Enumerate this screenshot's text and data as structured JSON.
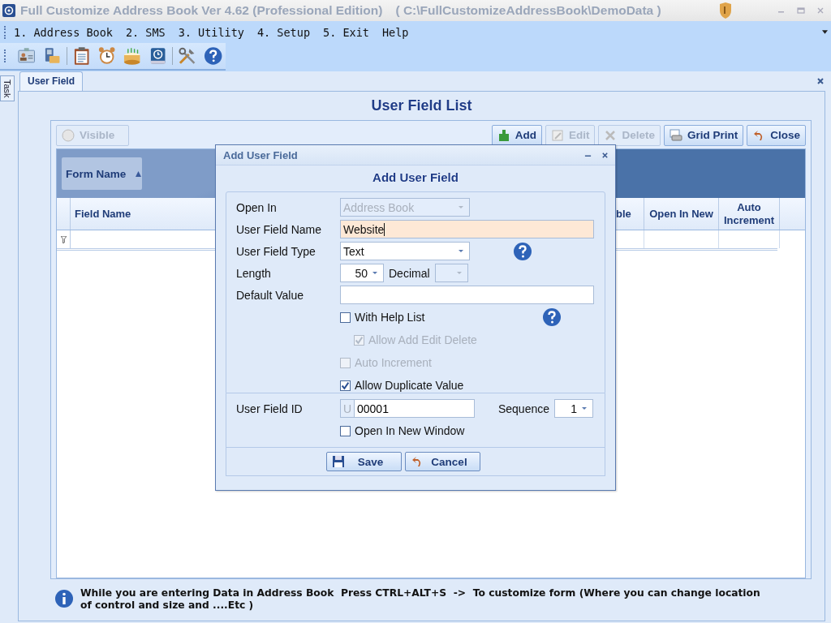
{
  "window": {
    "title": "Full Customize Address Book Ver 4.62 (Professional Edition)",
    "path": "( C:\\FullCustomizeAddressBook\\DemoData )"
  },
  "menu": [
    {
      "label": "1. Address Book"
    },
    {
      "label": "2. SMS"
    },
    {
      "label": "3. Utility"
    },
    {
      "label": "4. Setup"
    },
    {
      "label": "5. Exit"
    },
    {
      "label": "Help"
    }
  ],
  "side_tab": "Task",
  "tabs": [
    {
      "label": "User Field",
      "selected": true
    }
  ],
  "heading": "User Field List",
  "toolbar_buttons": [
    {
      "label": "Visible",
      "kind": "radio",
      "disabled": true
    },
    {
      "label": "Add",
      "kind": "add",
      "disabled": false
    },
    {
      "label": "Edit",
      "kind": "edit",
      "disabled": true
    },
    {
      "label": "Delete",
      "kind": "delete",
      "disabled": true
    },
    {
      "label": "Grid Print",
      "kind": "print",
      "disabled": false
    },
    {
      "label": "Close",
      "kind": "close",
      "disabled": false
    }
  ],
  "group_panel": {
    "label": "Form Name"
  },
  "grid": {
    "columns": [
      "Field Name",
      "ble",
      "Open In New",
      "Auto Increment"
    ]
  },
  "dialog": {
    "title": "Add User Field",
    "heading": "Add User Field",
    "open_in": {
      "label": "Open In",
      "value": "Address Book",
      "disabled": true
    },
    "name": {
      "label": "User Field Name",
      "value": "Website"
    },
    "type": {
      "label": "User Field Type",
      "value": "Text"
    },
    "length": {
      "label": "Length",
      "value": "50",
      "decimal_label": "Decimal"
    },
    "default": {
      "label": "Default Value"
    },
    "options": [
      {
        "label": "With Help List",
        "checked": false,
        "disabled": false,
        "children": [
          {
            "label": "Allow Add Edit Delete",
            "checked": true,
            "disabled": true
          }
        ]
      },
      {
        "label": "Auto Increment",
        "checked": false,
        "disabled": true
      },
      {
        "label": "Allow Duplicate Value",
        "checked": true,
        "disabled": false
      }
    ],
    "id": {
      "label": "User Field ID",
      "prefix": "U",
      "value": "00001"
    },
    "sequence": {
      "label": "Sequence",
      "value": "1"
    },
    "new_window": {
      "label": "Open In New Window",
      "checked": false
    },
    "buttons": [
      {
        "label": "Save",
        "kind": "save"
      },
      {
        "label": "Cancel",
        "kind": "cancel"
      }
    ]
  },
  "info": "While you are entering Data in Address Book  Press CTRL+ALT+S  ->  To customize form (Where you can change location of control and size and ....Etc )"
}
